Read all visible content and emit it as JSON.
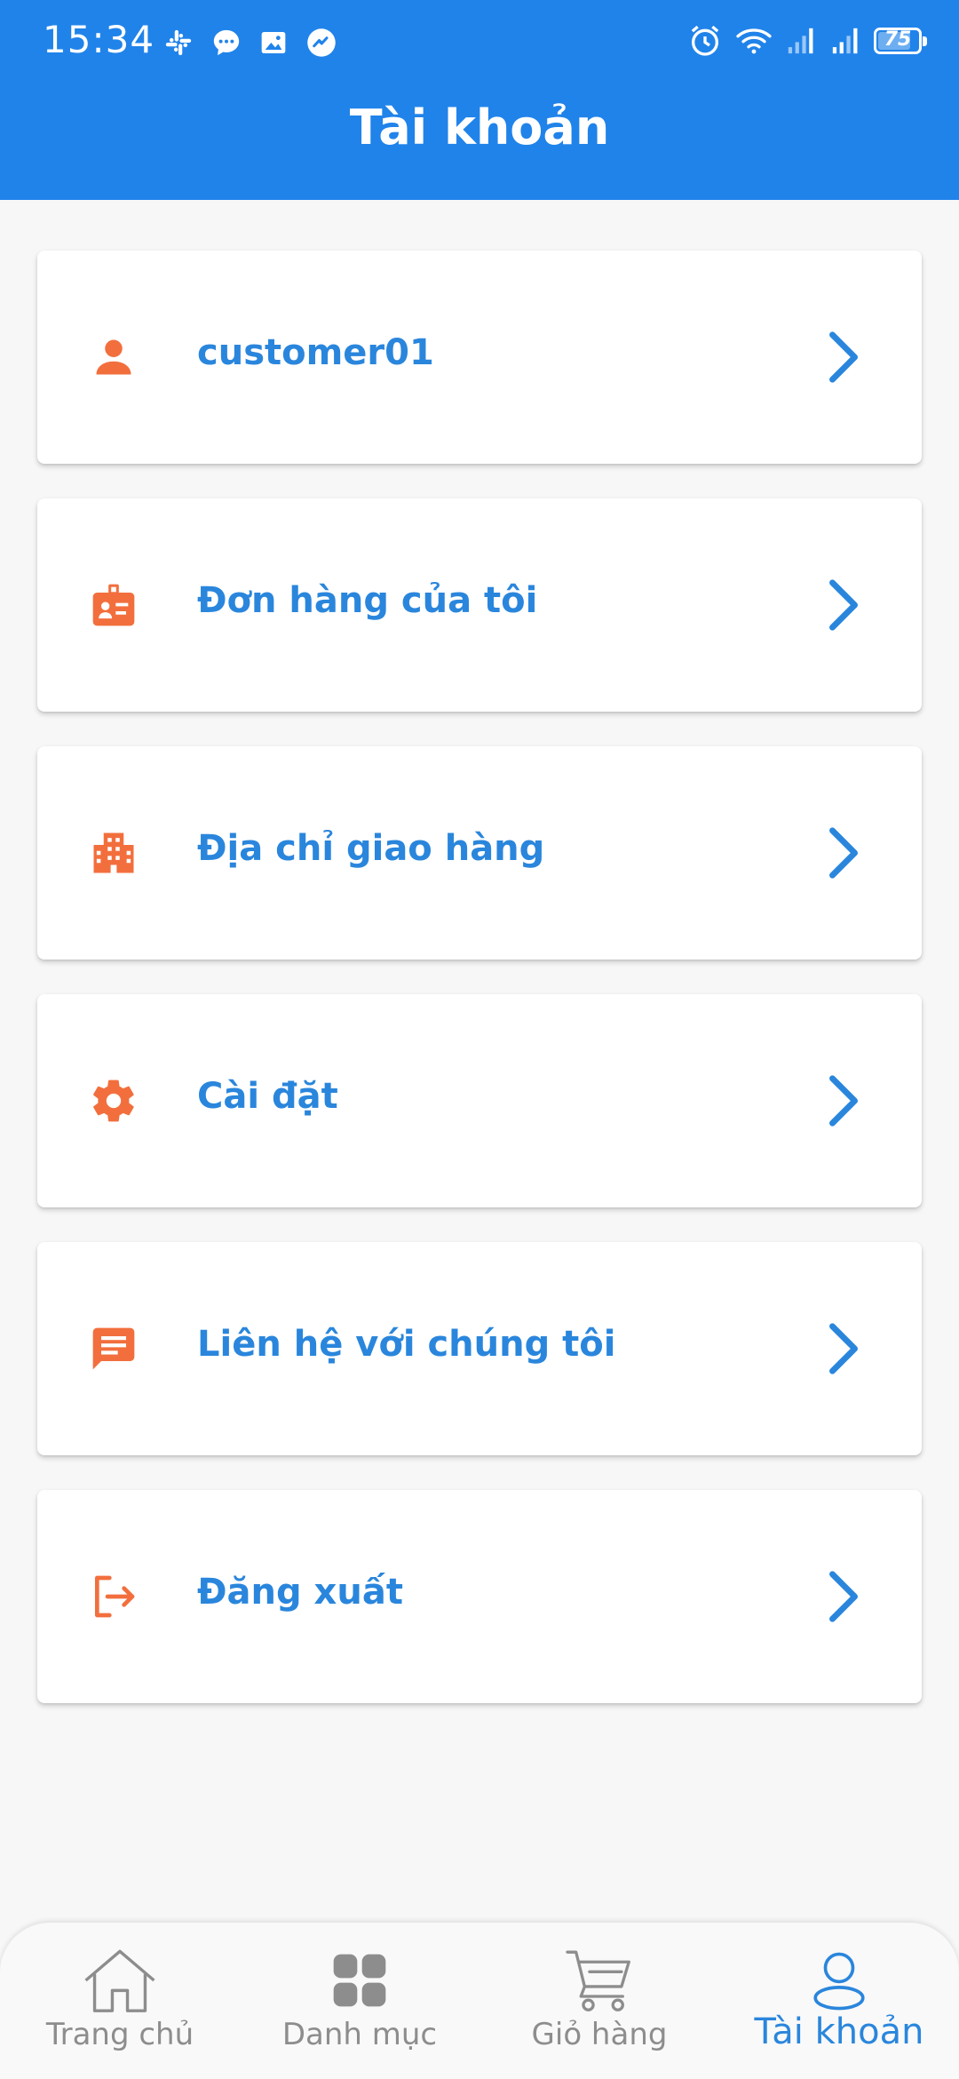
{
  "status_bar": {
    "time": "15:34",
    "left_icons": [
      "slack-icon",
      "chat-bubble-icon",
      "image-icon",
      "messenger-icon"
    ],
    "right_icons": [
      "alarm-icon",
      "wifi-icon",
      "signal-icon",
      "signal-icon",
      "battery-icon"
    ],
    "battery_level": "75"
  },
  "header": {
    "title": "Tài khoản"
  },
  "menu": {
    "items": [
      {
        "label": "customer01",
        "icon": "person-icon"
      },
      {
        "label": "Đơn hàng của tôi",
        "icon": "id-badge-icon"
      },
      {
        "label": "Địa chỉ giao hàng",
        "icon": "building-icon"
      },
      {
        "label": "Cài đặt",
        "icon": "gear-icon"
      },
      {
        "label": "Liên hệ với chúng tôi",
        "icon": "message-icon"
      },
      {
        "label": "Đăng xuất",
        "icon": "logout-icon"
      }
    ]
  },
  "bottom_nav": {
    "items": [
      {
        "label": "Trang chủ",
        "icon": "home-icon",
        "active": false
      },
      {
        "label": "Danh mục",
        "icon": "grid-icon",
        "active": false
      },
      {
        "label": "Giỏ hàng",
        "icon": "cart-icon",
        "active": false
      },
      {
        "label": "Tài khoản",
        "icon": "user-icon",
        "active": true
      }
    ]
  },
  "colors": {
    "header_bg": "#2083ea",
    "accent_blue": "#2a86dc",
    "icon_orange": "#f26f3d",
    "nav_inactive": "#8d8d8d"
  }
}
